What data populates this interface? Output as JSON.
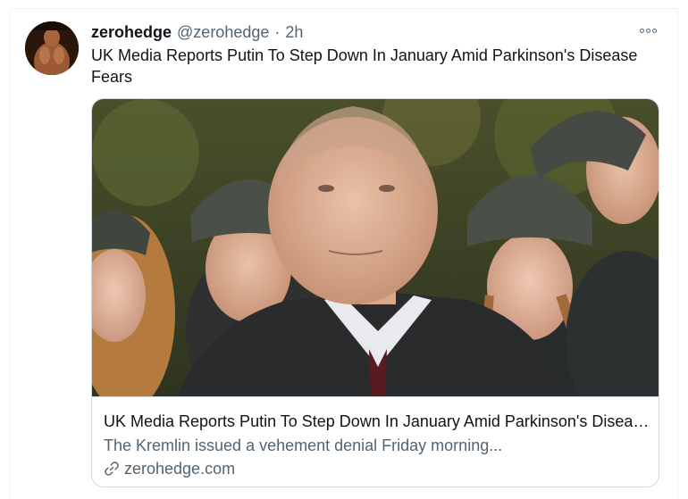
{
  "tweet": {
    "display_name": "zerohedge",
    "handle": "@zerohedge",
    "separator": "·",
    "time": "2h",
    "text": "UK Media Reports Putin To Step Down In January Amid Parkinson's Disease Fears"
  },
  "card": {
    "title": "UK Media Reports Putin To Step Down In January Amid Parkinson's Disease Fears",
    "description": "The Kremlin issued a vehement denial Friday morning...",
    "domain": "zerohedge.com"
  },
  "icons": {
    "more": "more-horizontal-icon",
    "link": "link-icon"
  },
  "colors": {
    "text_primary": "#0f1419",
    "text_secondary": "#536471",
    "border": "#cfd9de"
  }
}
